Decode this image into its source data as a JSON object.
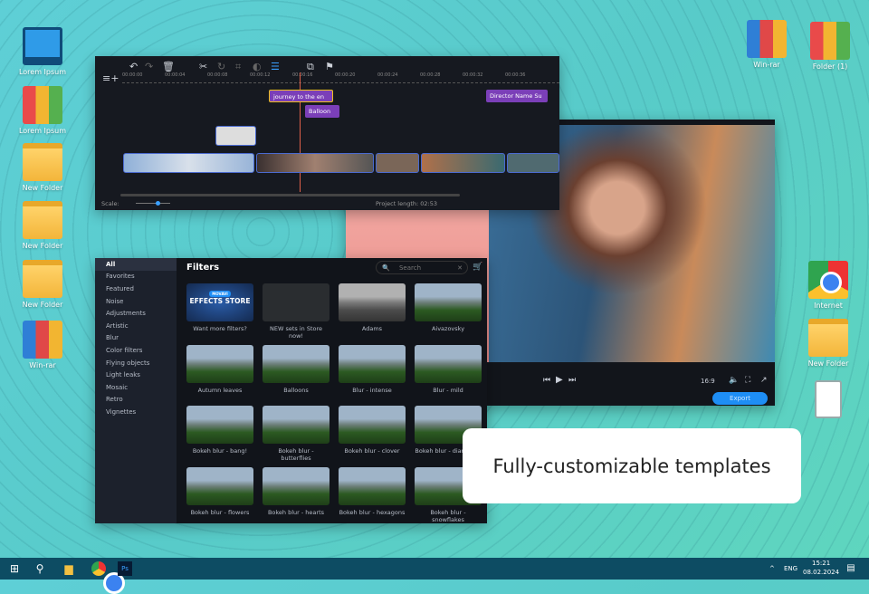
{
  "desktop": {
    "left": [
      {
        "label": "Lorem Ipsum",
        "icon": "computer-icon"
      },
      {
        "label": "Lorem Ipsum",
        "icon": "books-icon"
      },
      {
        "label": "New Folder",
        "icon": "folder-icon"
      },
      {
        "label": "New Folder",
        "icon": "folder-icon"
      },
      {
        "label": "New Folder",
        "icon": "folder-icon"
      },
      {
        "label": "Win-rar",
        "icon": "winrar-icon"
      }
    ],
    "right": [
      {
        "label": "Win-rar",
        "icon": "winrar-icon"
      },
      {
        "label": "Folder (1)",
        "icon": "books-icon"
      },
      {
        "label": "Internet",
        "icon": "chrome-icon"
      },
      {
        "label": "New Folder",
        "icon": "folder-icon"
      },
      {
        "label": "",
        "icon": "trash-icon"
      }
    ]
  },
  "timeline": {
    "ticks": [
      "00:00:00",
      "00:00:04",
      "00:00:08",
      "00:00:12",
      "00:00:16",
      "00:00:20",
      "00:00:24",
      "00:00:28",
      "00:00:32",
      "00:00:36"
    ],
    "titles": [
      "journey to the en",
      "Balloon",
      "Director Name Su"
    ],
    "scale_label": "Scale:",
    "project_length": "Project length:  02:53"
  },
  "preview": {
    "aspect": "16:9",
    "export_label": "Export"
  },
  "filters": {
    "title": "Filters",
    "search_placeholder": "Search",
    "categories": [
      "All",
      "Favorites",
      "Featured",
      "Noise",
      "Adjustments",
      "Artistic",
      "Blur",
      "Color filters",
      "Flying objects",
      "Light leaks",
      "Mosaic",
      "Retro",
      "Vignettes"
    ],
    "store_badge": "MOVAVI",
    "store_text": "EFFECTS STORE",
    "items": [
      "Want more filters?",
      "NEW sets in Store now!",
      "Adams",
      "Aivazovsky",
      "Autumn leaves",
      "Balloons",
      "Blur - intense",
      "Blur - mild",
      "Bokeh blur - bang!",
      "Bokeh blur - butterflies",
      "Bokeh blur - clover",
      "Bokeh blur - diamonds",
      "Bokeh blur - flowers",
      "Bokeh blur - hearts",
      "Bokeh blur - hexagons",
      "Bokeh blur - snowflakes"
    ]
  },
  "callout": "Fully-customizable templates",
  "taskbar": {
    "lang": "ENG",
    "time": "15:21",
    "date": "08.02.2024"
  }
}
